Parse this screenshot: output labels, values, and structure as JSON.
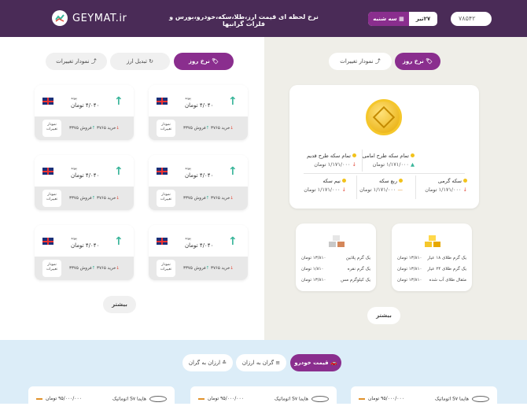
{
  "header": {
    "logo_text": "GEYMAT.ir",
    "title": "نرخ لحظه ای قیمت ارز،طلا،سکه،خودرو،بورس و فلزات گرانبها",
    "date_day": "۲۷تیر",
    "date_weekday": "سه شنبه",
    "search_value": "۷۸۵۴۲",
    "icons": {
      "logo": "logo-icon",
      "calendar": "calendar-icon"
    }
  },
  "left_tabs": {
    "daily_rate": "نرخ روز",
    "convert": "تبدیل ارز",
    "chart": "نمودار تغییرات"
  },
  "right_tabs": {
    "daily_rate": "نرخ روز",
    "chart": "نمودار تغییرات"
  },
  "coins": {
    "full_new": {
      "label": "تمام سکه طرح امامی",
      "value": "۱/۱۷۱/۰۰۰ تومان"
    },
    "full_old": {
      "label": "تمام سکه طرح قدیم",
      "value": "۱/۱۷۱/۰۰۰ تومان"
    },
    "gram": {
      "label": "سکه گرمی",
      "value": "۱/۱۷۱/۰۰۰ تومان"
    },
    "quarter": {
      "label": "ربع سکه",
      "value": "۱/۱۷۱/۰۰۰ تومان"
    },
    "half": {
      "label": "نیم سکه",
      "value": "۱/۱۷۱/۰۰۰ تومان"
    }
  },
  "gold": {
    "rows": [
      {
        "label": "یک گرم طلای ۱۸ عیار",
        "value": "۱۳/۸۱۰ تومان"
      },
      {
        "label": "یک گرم طلای ۲۴ عیار",
        "value": "۱۳/۸۱۰ تومان"
      },
      {
        "label": "مثقال طلای آب شده",
        "value": "۱۳/۸۱۰ تومان"
      }
    ]
  },
  "metals": {
    "rows": [
      {
        "label": "یک گرم پلاتین",
        "value": "۱۳/۸۱۰ تومان"
      },
      {
        "label": "یک گرم نقره",
        "value": "۱/۸۱۰ تومان"
      },
      {
        "label": "یک کیلوگرم مس",
        "value": "۱۳/۸۱۰ تومان"
      }
    ]
  },
  "currency_card": {
    "name": "پوند",
    "price": "۴/۰۴۰ تومان",
    "buy": "خرید ۳۷۶۵",
    "sell": "فروش ۳۳۷۵",
    "chart_btn": "نمودار تغییرات"
  },
  "more_label": "بیشتر",
  "cars": {
    "tabs": {
      "price": "قیمت خودرو",
      "cheap": "گران به ارزان",
      "expensive": "ارزان به گران"
    },
    "items": [
      {
        "name": "هایما S۷ اتوماتیک",
        "price": "۹۵/۰۰۰/۰۰۰ تومان"
      },
      {
        "name": "هایما S۷ اتوماتیک",
        "price": "۹۵/۰۰۰/۰۰۰ تومان"
      },
      {
        "name": "هایما S۷ اتوماتیک",
        "price": "۹۵/۰۰۰/۰۰۰ تومان"
      }
    ]
  }
}
